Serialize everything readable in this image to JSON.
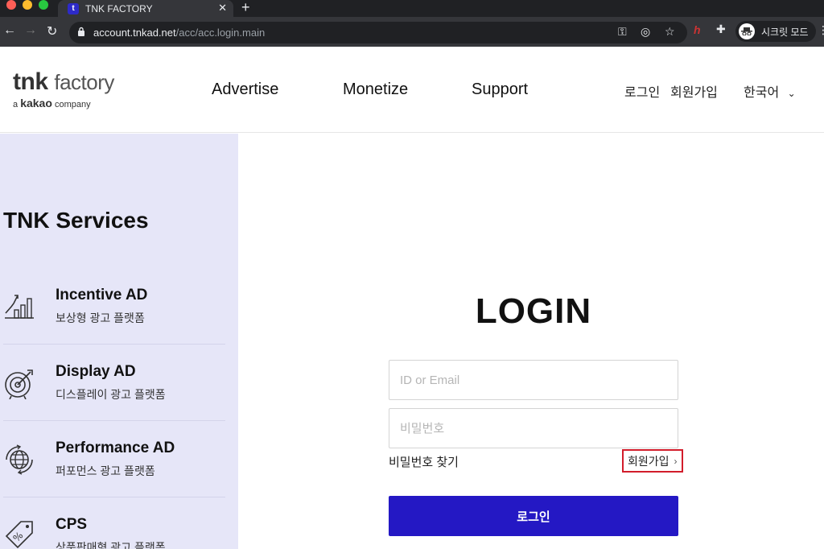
{
  "browser": {
    "tab_title": "TNK FACTORY",
    "tab_favicon": "t",
    "url_host": "account.tnkad.net",
    "url_path": "/acc/acc.login.main",
    "profile_label": "시크릿 모드",
    "icons": [
      "back-icon",
      "forward-icon",
      "reload-icon",
      "lock-icon",
      "key-icon",
      "eye-off-icon",
      "star-icon",
      "extension-icon",
      "puzzle-icon",
      "incognito-icon",
      "more-icon"
    ]
  },
  "header": {
    "logo_main_a": "tnk",
    "logo_main_b": "factory",
    "logo_sub_a": "a",
    "logo_sub_b": "kakao",
    "logo_sub_c": "company",
    "nav": [
      "Advertise",
      "Monetize",
      "Support"
    ],
    "login": "로그인",
    "signup": "회원가입",
    "language": "한국어"
  },
  "sidebar": {
    "title": "TNK Services",
    "services": [
      {
        "name": "Incentive AD",
        "desc": "보상형 광고 플랫폼",
        "icon": "growth-chart-icon"
      },
      {
        "name": "Display AD",
        "desc": "디스플레이 광고 플랫폼",
        "icon": "target-icon"
      },
      {
        "name": "Performance AD",
        "desc": "퍼포먼스 광고 플랫폼",
        "icon": "globe-icon"
      },
      {
        "name": "CPS",
        "desc": "상품판매형 광고 플랫폼",
        "icon": "discount-tag-icon"
      }
    ]
  },
  "login": {
    "title": "LOGIN",
    "id_placeholder": "ID or Email",
    "pw_placeholder": "비밀번호",
    "find_password": "비밀번호 찾기",
    "signup": "회원가입",
    "button": "로그인"
  },
  "colors": {
    "sidebar_bg": "#e6e6f8",
    "login_button": "#2418c4",
    "highlight_border": "#d21d2b"
  }
}
